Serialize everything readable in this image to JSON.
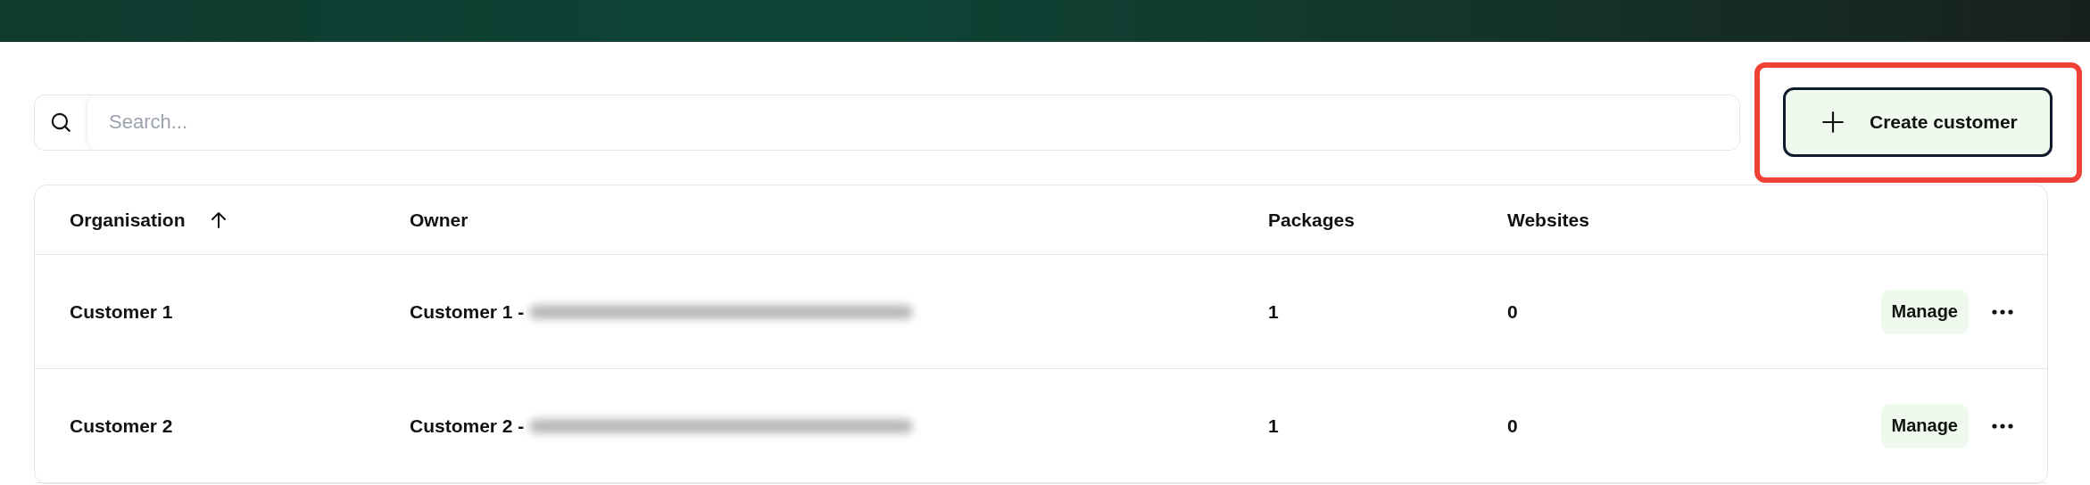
{
  "search": {
    "placeholder": "Search..."
  },
  "create_button": {
    "label": "Create customer",
    "highlighted": true
  },
  "table": {
    "columns": [
      {
        "label": "Organisation",
        "sorted": true
      },
      {
        "label": "Owner",
        "sorted": false
      },
      {
        "label": "Packages",
        "sorted": false
      },
      {
        "label": "Websites",
        "sorted": false
      }
    ],
    "rows": [
      {
        "organisation": "Customer 1",
        "owner": "Customer 1 -",
        "owner_email_blurred": true,
        "packages": "1",
        "websites": "0",
        "action": "Manage"
      },
      {
        "organisation": "Customer 2",
        "owner": "Customer 2 -",
        "owner_email_blurred": true,
        "packages": "1",
        "websites": "0",
        "action": "Manage"
      }
    ]
  }
}
